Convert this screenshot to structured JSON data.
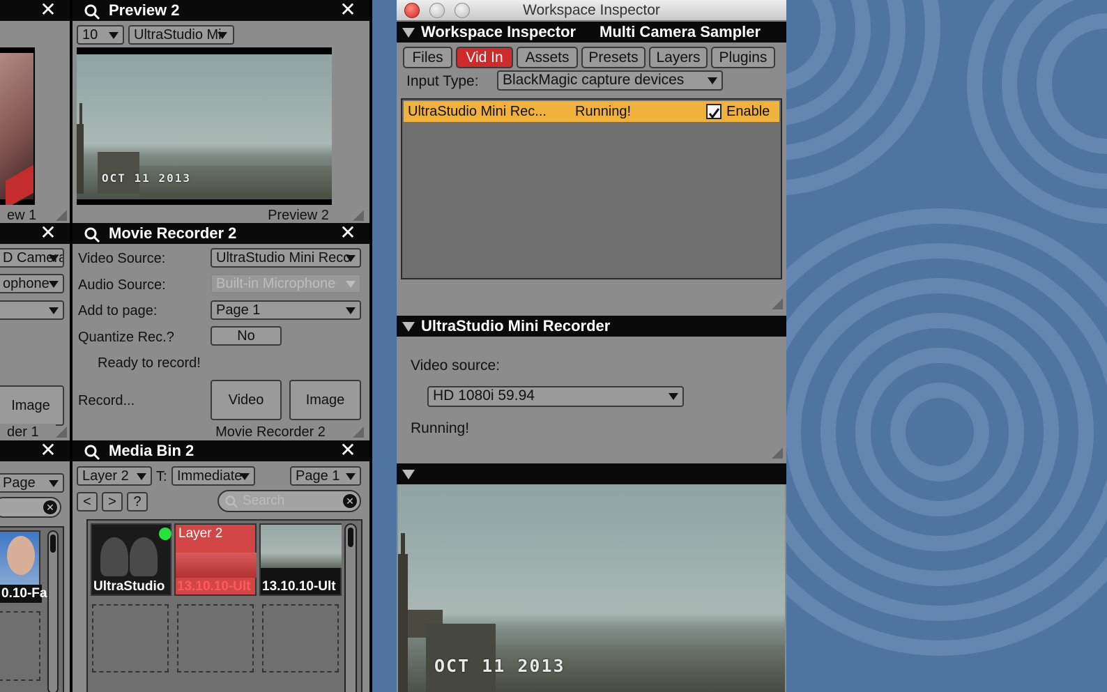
{
  "left_column": {
    "preview1_footer": "ew 1",
    "source_select": "D Camera",
    "mic_select": "ophone",
    "image_button": "Image",
    "recorder1_footer": "der 1",
    "page_select": "Page",
    "media_caption": "0.10-Fa"
  },
  "preview2": {
    "title": "Preview 2",
    "zoom": "10",
    "source": "UltraStudio Mi",
    "timestamp": "OCT 11 2013",
    "footer": "Preview 2"
  },
  "movie_recorder2": {
    "title": "Movie Recorder 2",
    "video_source_label": "Video Source:",
    "video_source": "UltraStudio Mini Reco",
    "audio_source_label": "Audio Source:",
    "audio_source": "Built-in Microphone",
    "add_to_page_label": "Add to page:",
    "add_to_page": "Page 1",
    "quantize_label": "Quantize Rec.?",
    "quantize": "No",
    "status": "Ready to record!",
    "record_label": "Record...",
    "video_button": "Video",
    "image_button": "Image",
    "footer": "Movie Recorder 2"
  },
  "media_bin2": {
    "title": "Media Bin 2",
    "layer": "Layer 2",
    "t_label": "T:",
    "transition": "Immediate",
    "page": "Page 1",
    "nav": [
      "<",
      ">",
      "?"
    ],
    "search_placeholder": "Search",
    "items": [
      {
        "caption": "UltraStudio",
        "overlay": ""
      },
      {
        "caption": "13.10.10-Ult",
        "overlay": "Layer 2"
      },
      {
        "caption": "13.10.10-Ult",
        "overlay": ""
      }
    ]
  },
  "inspector": {
    "window_title": "Workspace Inspector",
    "header_title": "Workspace Inspector",
    "header_workspace": "Multi Camera Sampler",
    "tabs": [
      "Files",
      "Vid In",
      "Assets",
      "Presets",
      "Layers",
      "Plugins"
    ],
    "active_tab": "Vid In",
    "input_type_label": "Input Type:",
    "input_type": "BlackMagic capture devices",
    "device_name": "UltraStudio Mini Rec...",
    "device_status": "Running!",
    "enable_label": "Enable",
    "section2_title": "UltraStudio Mini Recorder",
    "video_source_label": "Video source:",
    "video_source": "HD 1080i 59.94",
    "running_text": "Running!",
    "preview_timestamp": "OCT 11 2013"
  },
  "colors": {
    "active_tab": "#cf2b2b",
    "device_row": "#f0b23b",
    "panel_bg": "#8c8c8c",
    "wallpaper": "#4f74a0"
  }
}
